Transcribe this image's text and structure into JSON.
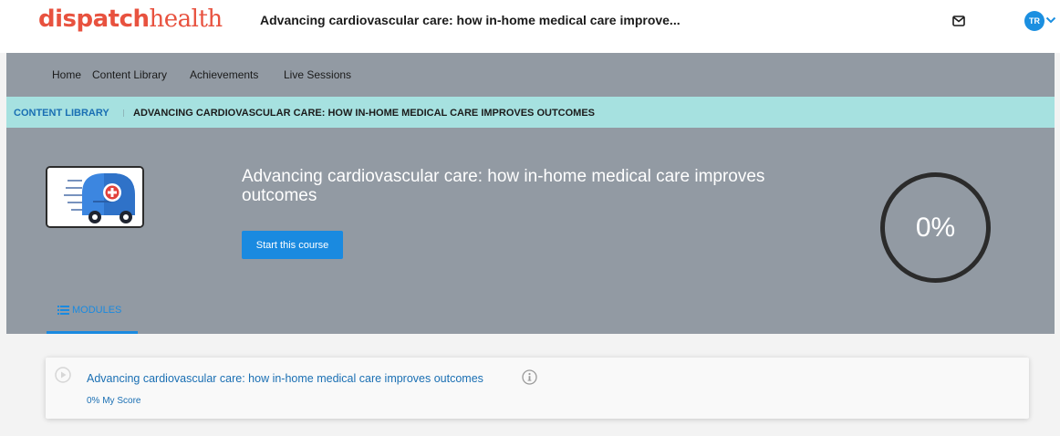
{
  "header": {
    "logo_part1": "dispatch",
    "logo_part2": "health",
    "title": "Advancing cardiovascular care: how in-home medical care improve...",
    "avatar_initials": "TR"
  },
  "nav": {
    "items": [
      {
        "label": "Home"
      },
      {
        "label": "Content Library"
      },
      {
        "label": "Achievements"
      },
      {
        "label": "Live Sessions"
      }
    ]
  },
  "breadcrumb": {
    "parent": "CONTENT LIBRARY",
    "current": "ADVANCING CARDIOVASCULAR CARE: HOW IN-HOME MEDICAL CARE IMPROVES OUTCOMES"
  },
  "course": {
    "title": "Advancing cardiovascular care: how in-home medical care improves outcomes",
    "start_label": "Start this course",
    "progress_percent": 0,
    "progress_text": "0%"
  },
  "tabs": {
    "modules_label": "MODULES"
  },
  "modules": [
    {
      "title": "Advancing cardiovascular care: how in-home medical care improves outcomes",
      "score": "0% My Score"
    }
  ],
  "icons": {
    "mail": "mail-icon",
    "chevron": "chevron-down-icon",
    "list": "list-icon",
    "play": "play-circle-icon",
    "info": "info-icon"
  },
  "colors": {
    "brand": "#e8523f",
    "accent": "#1a8ae0",
    "hero_bg": "#929aa3",
    "breadcrumb_bg": "#a6e1e0"
  }
}
